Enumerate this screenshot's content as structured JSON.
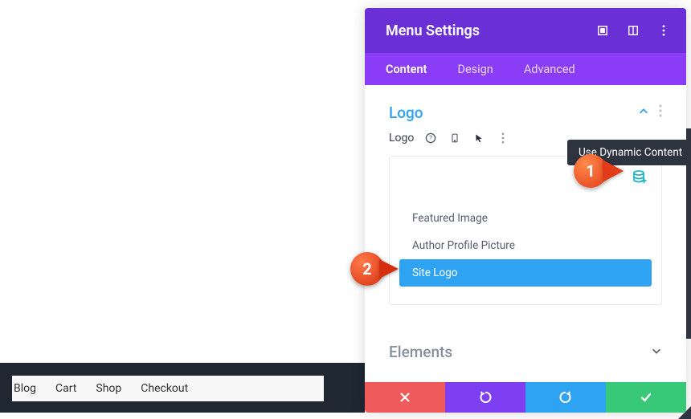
{
  "footer": {
    "links": [
      "Blog",
      "Cart",
      "Shop",
      "Checkout"
    ]
  },
  "panel": {
    "title": "Menu Settings",
    "tabs": {
      "content": "Content",
      "design": "Design",
      "advanced": "Advanced",
      "active": "content"
    },
    "section_logo": {
      "title": "Logo",
      "field_label": "Logo",
      "dynamic_items": [
        "Featured Image",
        "Author Profile Picture",
        "Site Logo"
      ],
      "selected_index": 2
    },
    "section_elements": {
      "title": "Elements"
    }
  },
  "tooltip": {
    "text": "Use Dynamic Content"
  },
  "callouts": {
    "one": "1",
    "two": "2"
  }
}
